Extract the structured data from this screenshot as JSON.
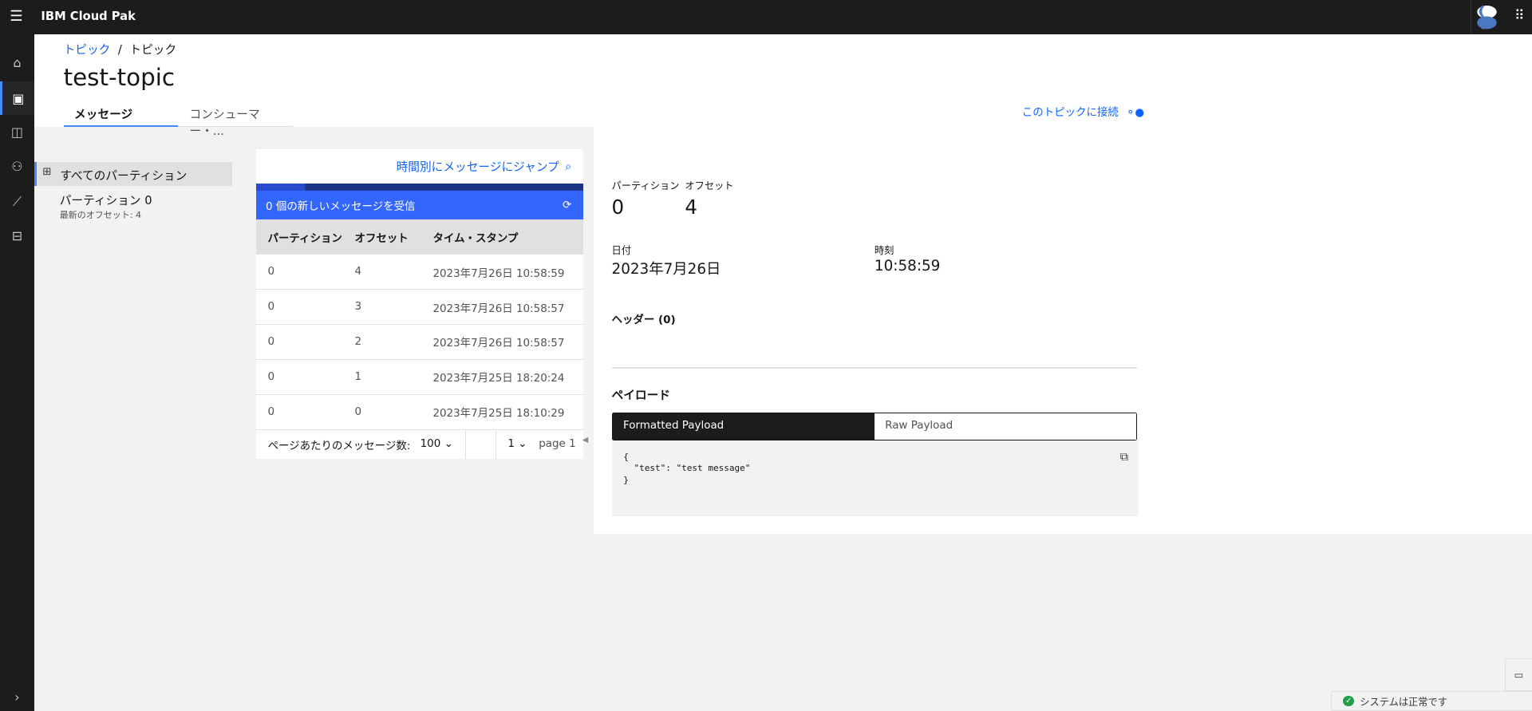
{
  "app": {
    "title": "IBM Cloud Pak"
  },
  "breadcrumb": {
    "parent": "トピック",
    "separator": "/",
    "current": "トピック"
  },
  "page": {
    "title": "test-topic"
  },
  "tabs": [
    {
      "label": "メッセージ",
      "selected": true
    },
    {
      "label": "コンシューマー・..."
    }
  ],
  "connect_link": "このトピックに接続",
  "partitions_nav": {
    "all": "すべてのパーティション",
    "items": [
      {
        "label": "パーティション 0",
        "sub": "最新のオフセット: 4"
      }
    ]
  },
  "table": {
    "jump_link": "時間別にメッセージにジャンプ",
    "new_messages": "0 個の新しいメッセージを受信",
    "headers": [
      "パーティション",
      "オフセット",
      "タイム・スタンプ"
    ],
    "rows": [
      [
        "0",
        "4",
        "2023年7月26日 10:58:59"
      ],
      [
        "0",
        "3",
        "2023年7月26日 10:58:57"
      ],
      [
        "0",
        "2",
        "2023年7月26日 10:58:57"
      ],
      [
        "0",
        "1",
        "2023年7月25日 18:20:24"
      ],
      [
        "0",
        "0",
        "2023年7月25日 18:10:29"
      ]
    ],
    "pagination": {
      "per_page_label": "ページあたりのメッセージ数:",
      "per_page": "100",
      "page_select": "1",
      "page_label": "page 1"
    }
  },
  "detail": {
    "partition_label": "パーティション",
    "partition": "0",
    "offset_label": "オフセット",
    "offset": "4",
    "date_label": "日付",
    "date": "2023年7月26日",
    "time_label": "時刻",
    "time": "10:58:59",
    "headers_label": "ヘッダー (0)",
    "payload_label": "ペイロード",
    "payload_tabs": [
      "Formatted Payload",
      "Raw Payload"
    ],
    "payload_lines": [
      "{",
      "  \"test\": \"test message\"",
      "}"
    ]
  },
  "status": {
    "text": "システムは正常です",
    "color": "#24a148"
  },
  "colors": {
    "accent": "#0f62fe",
    "banner": "#3366ff",
    "topbar": "#1c1c1c"
  }
}
